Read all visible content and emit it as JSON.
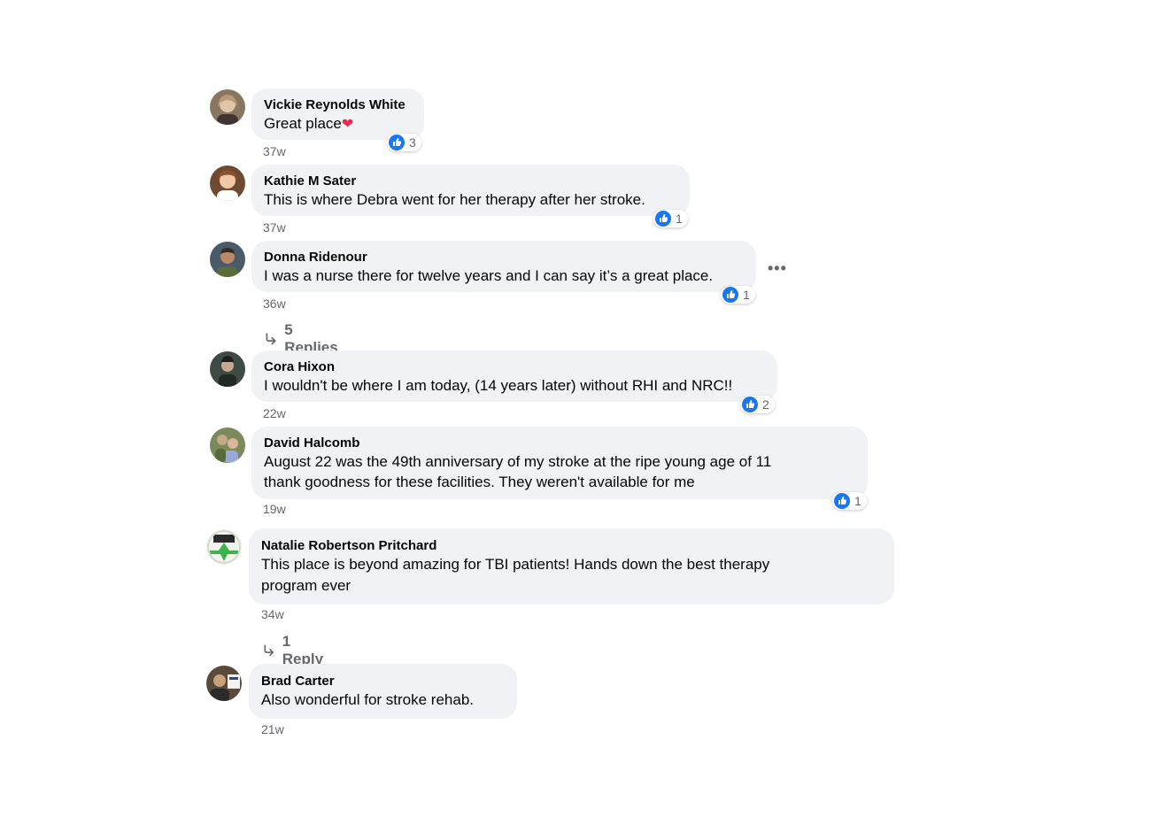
{
  "colors": {
    "bubble_bg": "#f0f2f5",
    "meta_text": "#65676b",
    "like_blue": "#1877f2",
    "heart_red": "#f0284a"
  },
  "comments": [
    {
      "name": "Vickie Reynolds White",
      "text": "Great place",
      "emoji": "heart-emoji",
      "time": "37w",
      "reactions": "3"
    },
    {
      "name": "Kathie M Sater",
      "text": "This is where Debra went for her therapy after her stroke.",
      "time": "37w",
      "reactions": "1"
    },
    {
      "name": "Donna Ridenour",
      "text": "I was a nurse there for twelve years and I can say it’s a great place.",
      "time": "36w",
      "reactions": "1",
      "replies": "5 Replies",
      "more_icon": "ellipsis-icon"
    },
    {
      "name": "Cora Hixon",
      "text": "I wouldn't be where I am today, (14 years later) without RHI and NRC!!",
      "time": "22w",
      "reactions": "2"
    },
    {
      "name": "David Halcomb",
      "text_lines": [
        "August 22 was the 49th anniversary of my stroke at the ripe young age of 11",
        "thank goodness for these facilities. They weren't available for me"
      ],
      "time": "19w",
      "reactions": "1"
    },
    {
      "name": "Natalie Robertson Pritchard",
      "text_lines": [
        "This place is beyond amazing for TBI patients! Hands down the best therapy",
        "program ever"
      ],
      "time": "34w",
      "replies": "1 Reply"
    },
    {
      "name": "Brad Carter",
      "text": "Also wonderful for stroke rehab.",
      "time": "21w"
    }
  ]
}
